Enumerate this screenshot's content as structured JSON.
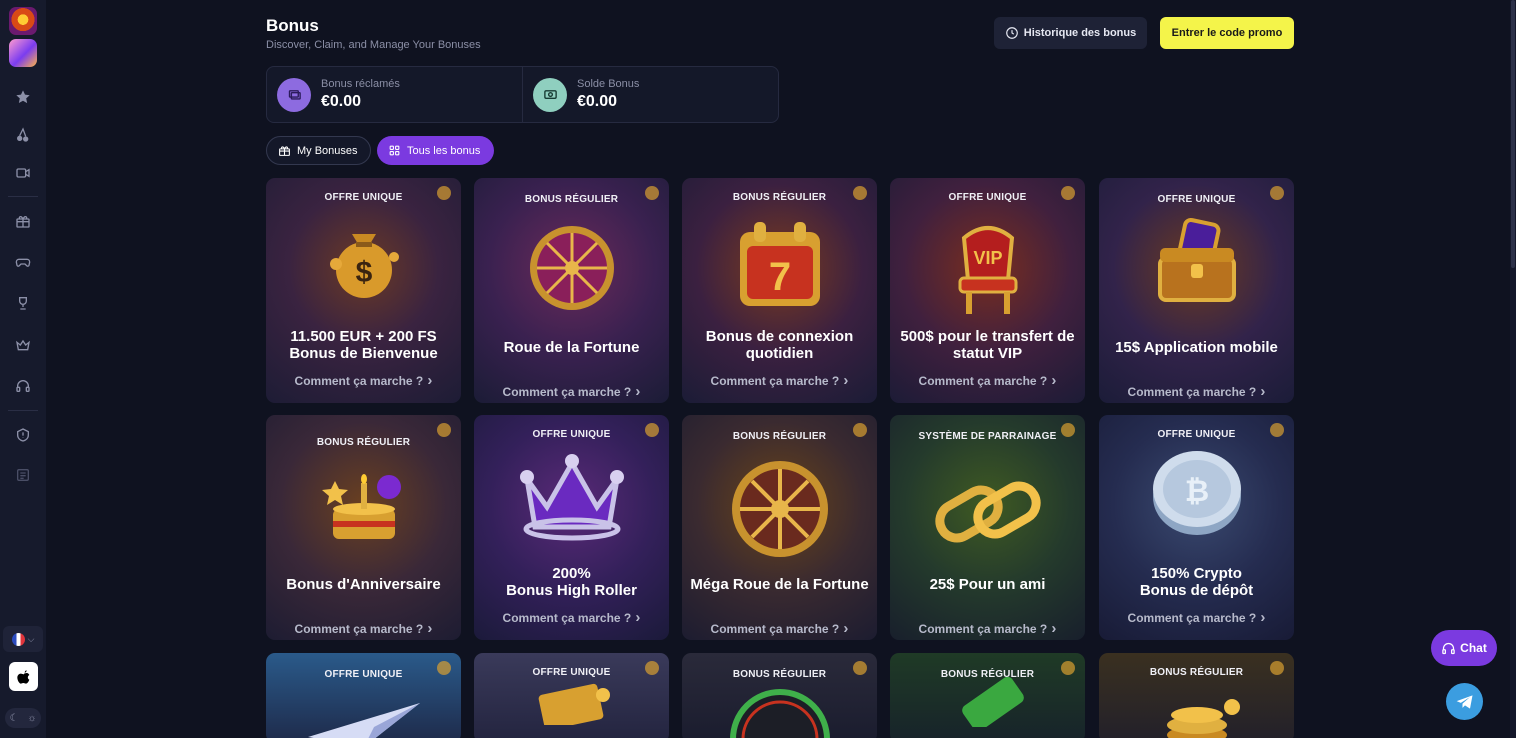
{
  "header": {
    "title": "Bonus",
    "subtitle": "Discover, Claim, and Manage Your Bonuses",
    "history_label": "Historique des bonus",
    "promo_label": "Entrer le code promo"
  },
  "stats": [
    {
      "label": "Bonus réclamés",
      "value": "€0.00"
    },
    {
      "label": "Solde Bonus",
      "value": "€0.00"
    }
  ],
  "tabs": [
    {
      "label": "My Bonuses",
      "active": false
    },
    {
      "label": "Tous les bonus",
      "active": true
    }
  ],
  "cards": [
    {
      "tag": "OFFRE UNIQUE",
      "title": "11.500 EUR + 200 FS\nBonus de Bienvenue",
      "link": "Comment ça marche ?",
      "art": "money-bag-icon"
    },
    {
      "tag": "BONUS RÉGULIER",
      "title": "Roue de la Fortune",
      "link": "Comment ça marche ?",
      "art": "wheel-icon"
    },
    {
      "tag": "BONUS RÉGULIER",
      "title": "Bonus de connexion quotidien",
      "link": "Comment ça marche ?",
      "art": "calendar-icon"
    },
    {
      "tag": "OFFRE UNIQUE",
      "title": "500$ pour le transfert de statut VIP",
      "link": "Comment ça marche ?",
      "art": "vip-throne-icon"
    },
    {
      "tag": "OFFRE UNIQUE",
      "title": "15$ Application mobile",
      "link": "Comment ça marche ?",
      "art": "treasure-chest-icon"
    },
    {
      "tag": "BONUS RÉGULIER",
      "title": "Bonus d'Anniversaire",
      "link": "Comment ça marche ?",
      "art": "birthday-cake-icon"
    },
    {
      "tag": "OFFRE UNIQUE",
      "title": "200%\nBonus High Roller",
      "link": "Comment ça marche ?",
      "art": "crown-icon"
    },
    {
      "tag": "BONUS RÉGULIER",
      "title": "Méga Roue de la Fortune",
      "link": "Comment ça marche ?",
      "art": "mega-wheel-icon"
    },
    {
      "tag": "SYSTÈME DE PARRAINAGE",
      "title": "25$ Pour un ami",
      "link": "Comment ça marche ?",
      "art": "chain-link-icon"
    },
    {
      "tag": "OFFRE UNIQUE",
      "title": "150% Crypto\nBonus de dépôt",
      "link": "Comment ça marche ?",
      "art": "crypto-coin-icon"
    },
    {
      "tag": "OFFRE UNIQUE",
      "title": "",
      "link": "",
      "art": "paper-plane-icon"
    },
    {
      "tag": "OFFRE UNIQUE",
      "title": "",
      "link": "",
      "art": "scroll-icon"
    },
    {
      "tag": "BONUS RÉGULIER",
      "title": "",
      "link": "",
      "art": "speedometer-icon"
    },
    {
      "tag": "BONUS RÉGULIER",
      "title": "",
      "link": "",
      "art": "battery-icon"
    },
    {
      "tag": "BONUS RÉGULIER",
      "title": "",
      "link": "",
      "art": "coin-stack-icon"
    }
  ],
  "chat_label": "Chat",
  "colors": {
    "accent": "#7b3ae0",
    "promo": "#f4f44a",
    "background": "#0f1220"
  }
}
